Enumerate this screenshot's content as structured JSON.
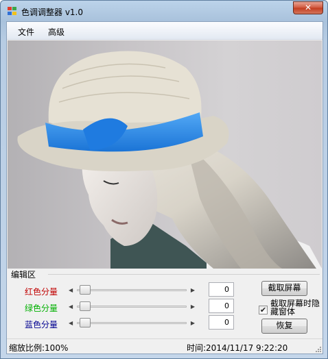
{
  "window": {
    "title": "色调调整器 v1.0",
    "close_label": "✕"
  },
  "menu": {
    "items": [
      "文件",
      "高级"
    ]
  },
  "edit_group": {
    "title": "编辑区",
    "channels": [
      {
        "label": "红色分量",
        "value": "0",
        "color": "#c00000",
        "slider_level": 0
      },
      {
        "label": "绿色分量",
        "value": "0",
        "color": "#00b000",
        "slider_level": 0
      },
      {
        "label": "蓝色分量",
        "value": "0",
        "color": "#000090",
        "slider_level": 0
      }
    ],
    "capture_button": "截取屏幕",
    "hide_checkbox": {
      "label": "截取屏幕时隐藏窗体",
      "checked": true
    },
    "restore_button": "恢复"
  },
  "statusbar": {
    "zoom": "缩放比例:100%",
    "time": "时间:2014/11/17 9:22:20"
  },
  "icons": {
    "app": "app-icon",
    "close": "close-icon",
    "slider_left": "arrow-left-icon",
    "slider_right": "arrow-right-icon",
    "grip": "resize-grip-icon"
  },
  "colors": {
    "hat_ribbon": "#2f8fea",
    "hat": "#e6e1d4"
  }
}
